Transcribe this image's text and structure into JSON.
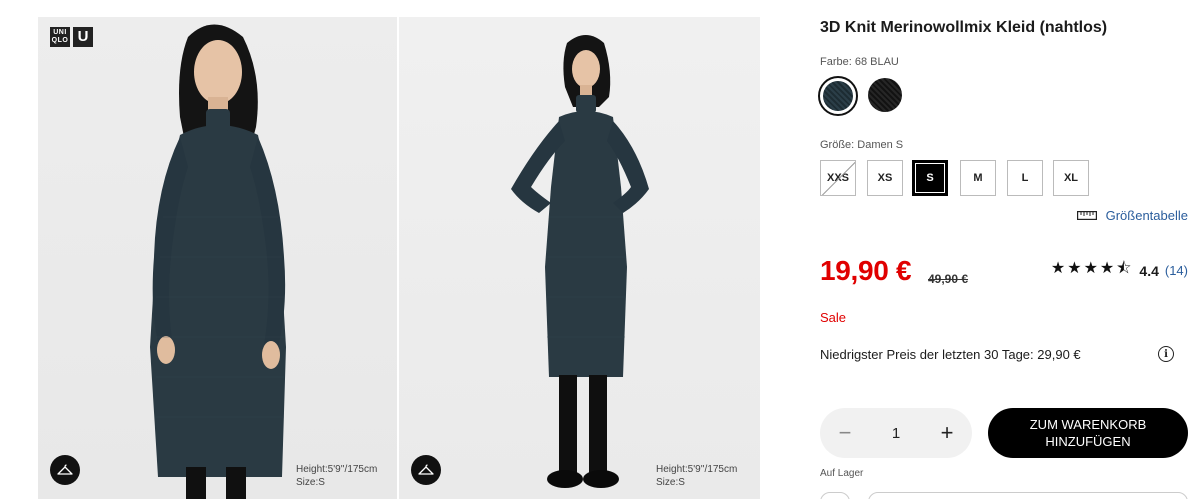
{
  "gallery": {
    "brand_logo": {
      "box1": "UNI QLO",
      "box2": "U"
    },
    "images": [
      {
        "alt": "Model trägt 3D Knit Merinowollmix Kleid",
        "model_height": "Height:5'9''/175cm",
        "model_size": "Size:S",
        "hanger_icon": "hanger-icon"
      },
      {
        "alt": "Model trägt 3D Knit Merinowollmix Kleid, Ganzkörper",
        "model_height": "Height:5'9''/175cm",
        "model_size": "Size:S",
        "hanger_icon": "hanger-icon"
      }
    ]
  },
  "product": {
    "title": "3D Knit Merinowollmix Kleid (nahtlos)",
    "color_label": "Farbe: 68 BLAU",
    "colors": [
      {
        "name": "68 BLAU",
        "hex": "#25363f",
        "selected": true
      },
      {
        "name": "SCHWARZ",
        "hex": "#1a1a1a",
        "selected": false
      }
    ],
    "size_label": "Größe: Damen S",
    "sizes": [
      {
        "label": "XXS",
        "available": false,
        "selected": false
      },
      {
        "label": "XS",
        "available": true,
        "selected": false
      },
      {
        "label": "S",
        "available": true,
        "selected": true
      },
      {
        "label": "M",
        "available": true,
        "selected": false
      },
      {
        "label": "L",
        "available": true,
        "selected": false
      },
      {
        "label": "XL",
        "available": true,
        "selected": false
      }
    ],
    "size_chart_label": "Größentabelle",
    "size_chart_icon": "ruler-icon",
    "price": "19,90 €",
    "old_price": "49,90 €",
    "rating": {
      "stars": "★★★★⯪",
      "score": "4.4",
      "count": "(14)",
      "value": 4.4
    },
    "sale_label": "Sale",
    "lowest_price": "Niedrigster Preis der letzten 30 Tage: 29,90 €",
    "info_icon": "ⓘ",
    "quantity": {
      "minus": "−",
      "value": "1",
      "plus": "+"
    },
    "add_to_cart": "ZUM WARENKORB HINZUFÜGEN",
    "stock": "Auf Lager"
  },
  "colors": {
    "sale_red": "#e00000",
    "link_blue": "#2a5d9c",
    "black": "#000000"
  }
}
